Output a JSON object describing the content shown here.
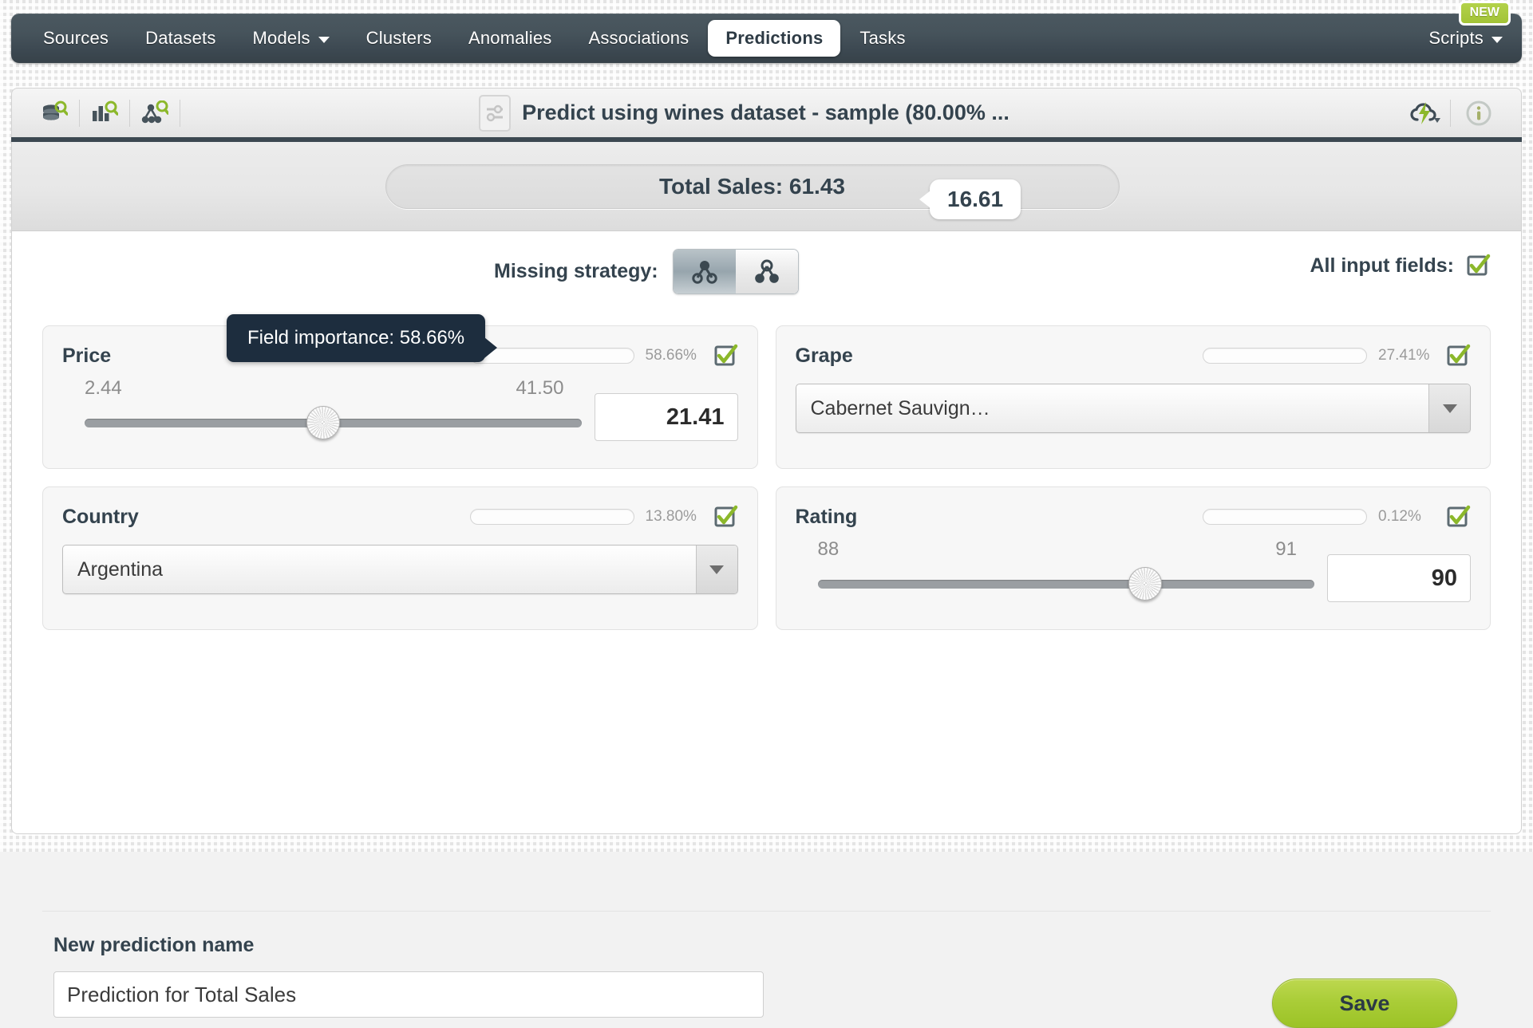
{
  "nav": {
    "items": [
      {
        "label": "Sources",
        "active": false,
        "caret": false
      },
      {
        "label": "Datasets",
        "active": false,
        "caret": false
      },
      {
        "label": "Models",
        "active": false,
        "caret": true
      },
      {
        "label": "Clusters",
        "active": false,
        "caret": false
      },
      {
        "label": "Anomalies",
        "active": false,
        "caret": false
      },
      {
        "label": "Associations",
        "active": false,
        "caret": false
      },
      {
        "label": "Predictions",
        "active": true,
        "caret": false
      },
      {
        "label": "Tasks",
        "active": false,
        "caret": false
      }
    ],
    "scripts_label": "Scripts",
    "new_badge": "NEW"
  },
  "toolbar": {
    "title": "Predict using wines dataset - sample (80.00% ...",
    "icons": [
      "dataset-search-icon",
      "model-search-icon",
      "tree-search-icon"
    ],
    "title_icon": "sliders-icon",
    "right_icons": [
      "cloud-lightning-icon",
      "info-icon"
    ]
  },
  "prediction": {
    "objective_label": "Total Sales: 61.43",
    "confidence": "16.61"
  },
  "options": {
    "missing_strategy_label": "Missing strategy:",
    "strategy_selected": 0,
    "strategy_options": [
      "last-prediction-icon",
      "proportional-icon"
    ],
    "all_input_fields_label": "All input fields:",
    "all_input_fields_checked": true
  },
  "tooltip": {
    "text": "Field importance: 58.66%"
  },
  "fields": [
    {
      "name": "Price",
      "type": "slider",
      "importance_pct": "58.66%",
      "importance_value": 58.66,
      "checked": true,
      "min": "2.44",
      "max": "41.50",
      "value": "21.41",
      "knob_pct": 48
    },
    {
      "name": "Grape",
      "type": "select",
      "importance_pct": "27.41%",
      "importance_value": 27.41,
      "checked": true,
      "value": "Cabernet Sauvign…"
    },
    {
      "name": "Country",
      "type": "select",
      "importance_pct": "13.80%",
      "importance_value": 13.8,
      "checked": true,
      "value": "Argentina"
    },
    {
      "name": "Rating",
      "type": "slider",
      "importance_pct": "0.12%",
      "importance_value": 0.12,
      "checked": true,
      "min": "88",
      "max": "91",
      "value": "90",
      "knob_pct": 66
    }
  ],
  "footer": {
    "name_label": "New prediction name",
    "name_value": "Prediction for Total Sales",
    "name_placeholder": "New prediction name",
    "save_label": "Save"
  },
  "colors": {
    "accent_green": "#b0ce41",
    "nav_dark": "#3c4851",
    "text_dark": "#34434e"
  }
}
